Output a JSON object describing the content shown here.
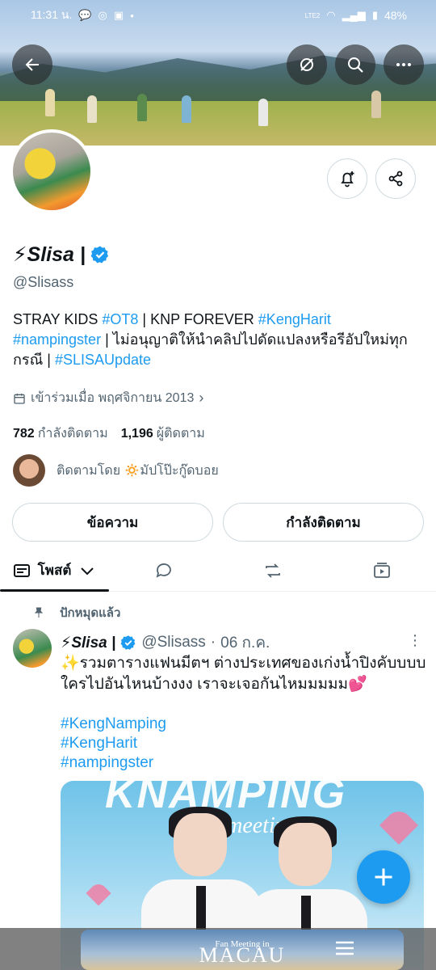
{
  "status_bar": {
    "time": "11:31 น.",
    "battery": "48%",
    "network": "LTE2"
  },
  "profile": {
    "display_name": "⚡Slisa |",
    "handle": "@Slisass",
    "bio_parts": {
      "p1": "STRAY KIDS ",
      "t1": "#OT8",
      "p2": " | KNP FOREVER ",
      "t2": "#KengHarit",
      "t3": "#nampingster",
      "p3": " | ไม่อนุญาติให้นำคลิปไปดัดแปลงหรือรีอัปใหม่ทุกกรณี | ",
      "t4": "#SLISAUpdate"
    },
    "joined": "เข้าร่วมเมื่อ พฤศจิกายน 2013",
    "following_count": "782",
    "following_label": "กำลังติดตาม",
    "followers_count": "1,196",
    "followers_label": "ผู้ติดตาม",
    "followed_by": "ติดตามโดย 🔅มัปโป๊ะกู๊ดบอย"
  },
  "buttons": {
    "message": "ข้อความ",
    "following": "กำลังติดตาม"
  },
  "tabs": {
    "posts": "โพสต์"
  },
  "pinned_label": "ปักหมุดแล้ว",
  "post": {
    "author": "⚡Slisa |",
    "handle": "@Slisass",
    "separator": "·",
    "date": "06 ก.ค.",
    "text": "✨รวมตารางแฟนมีตฯ ต่างประเทศของเก่งน้ำปิงคับบบบ ใครไปอันไหนบ้างงง เราจะเจอกันไหมมมมม💕",
    "hashtags": [
      "#KengNamping",
      "#KengHarit",
      "#nampingster"
    ],
    "media_title": "KNAMPING",
    "media_subtitle": "Fanmeeting"
  },
  "ad": {
    "line1": "Fan Meeting in",
    "line2": "MACAU"
  },
  "colors": {
    "accent": "#1d9bf0",
    "text": "#0f1419",
    "muted": "#536471",
    "border": "#cfd9de"
  }
}
